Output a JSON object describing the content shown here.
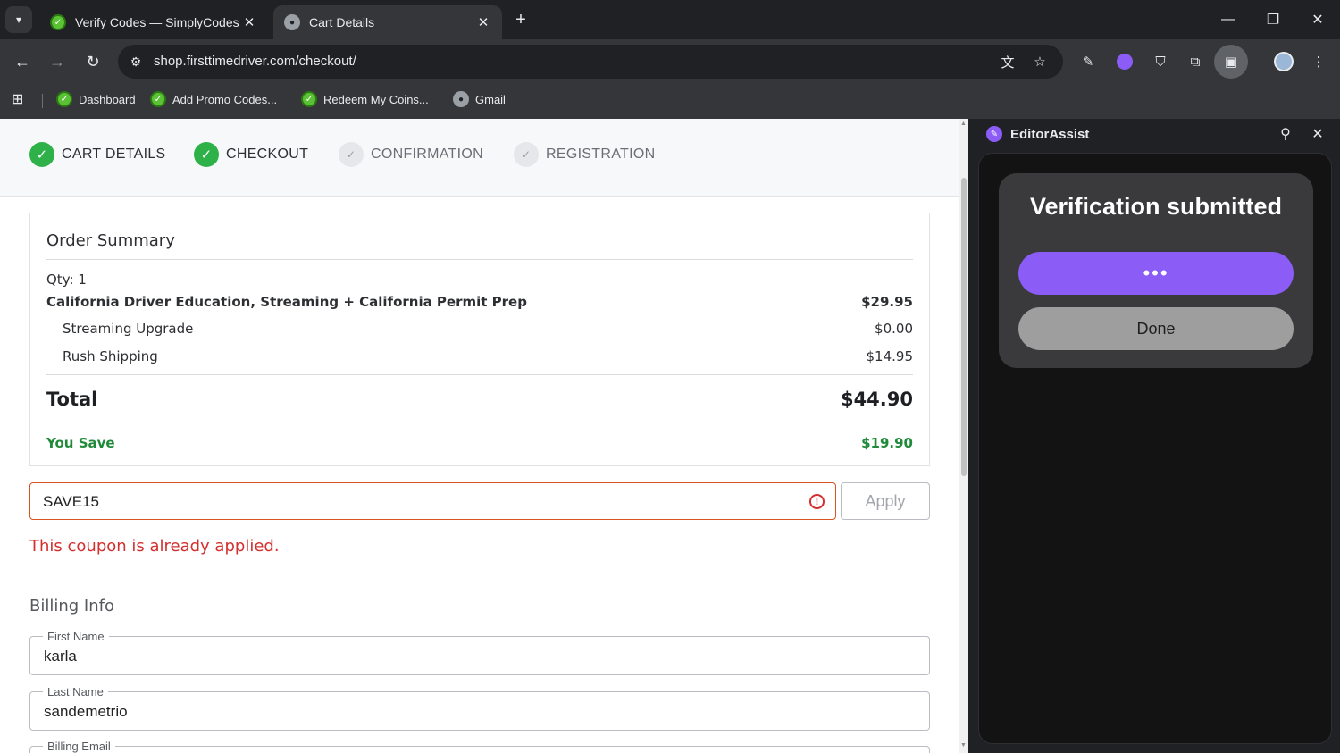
{
  "browser": {
    "tabs": [
      {
        "title": "Verify Codes — SimplyCodes",
        "active": false
      },
      {
        "title": "Cart Details",
        "active": true
      }
    ],
    "url": "shop.firsttimedriver.com/checkout/",
    "bookmarks": [
      {
        "label": "Dashboard",
        "icon": "simplycodes-icon"
      },
      {
        "label": "Add Promo Codes...",
        "icon": "simplycodes-icon"
      },
      {
        "label": "Redeem My Coins...",
        "icon": "simplycodes-icon"
      },
      {
        "label": "Gmail",
        "icon": "globe-icon"
      }
    ]
  },
  "stepper": {
    "steps": [
      {
        "label": "CART DETAILS",
        "status": "done"
      },
      {
        "label": "CHECKOUT",
        "status": "done"
      },
      {
        "label": "CONFIRMATION",
        "status": "todo"
      },
      {
        "label": "REGISTRATION",
        "status": "todo"
      }
    ]
  },
  "summary": {
    "title": "Order Summary",
    "qty": "Qty: 1",
    "product": {
      "name": "California Driver Education, Streaming + California Permit Prep",
      "price": "$29.95"
    },
    "addons": [
      {
        "name": "Streaming Upgrade",
        "price": "$0.00"
      },
      {
        "name": "Rush Shipping",
        "price": "$14.95"
      }
    ],
    "total_label": "Total",
    "total_value": "$44.90",
    "save_label": "You Save",
    "save_value": "$19.90"
  },
  "coupon": {
    "value": "SAVE15",
    "apply_label": "Apply",
    "error": "This coupon is already applied."
  },
  "billing": {
    "heading": "Billing Info",
    "fields": [
      {
        "label": "First Name",
        "value": "karla"
      },
      {
        "label": "Last Name",
        "value": "sandemetrio"
      },
      {
        "label": "Billing Email",
        "value": ""
      }
    ]
  },
  "sidepanel": {
    "title": "EditorAssist",
    "card_title": "Verification submitted",
    "primary_label": "•••",
    "secondary_label": "Done"
  },
  "colors": {
    "accent": "#8b5cf6",
    "success": "#2fb14a",
    "error": "#d32f2f",
    "save_green": "#1f8a3a"
  }
}
